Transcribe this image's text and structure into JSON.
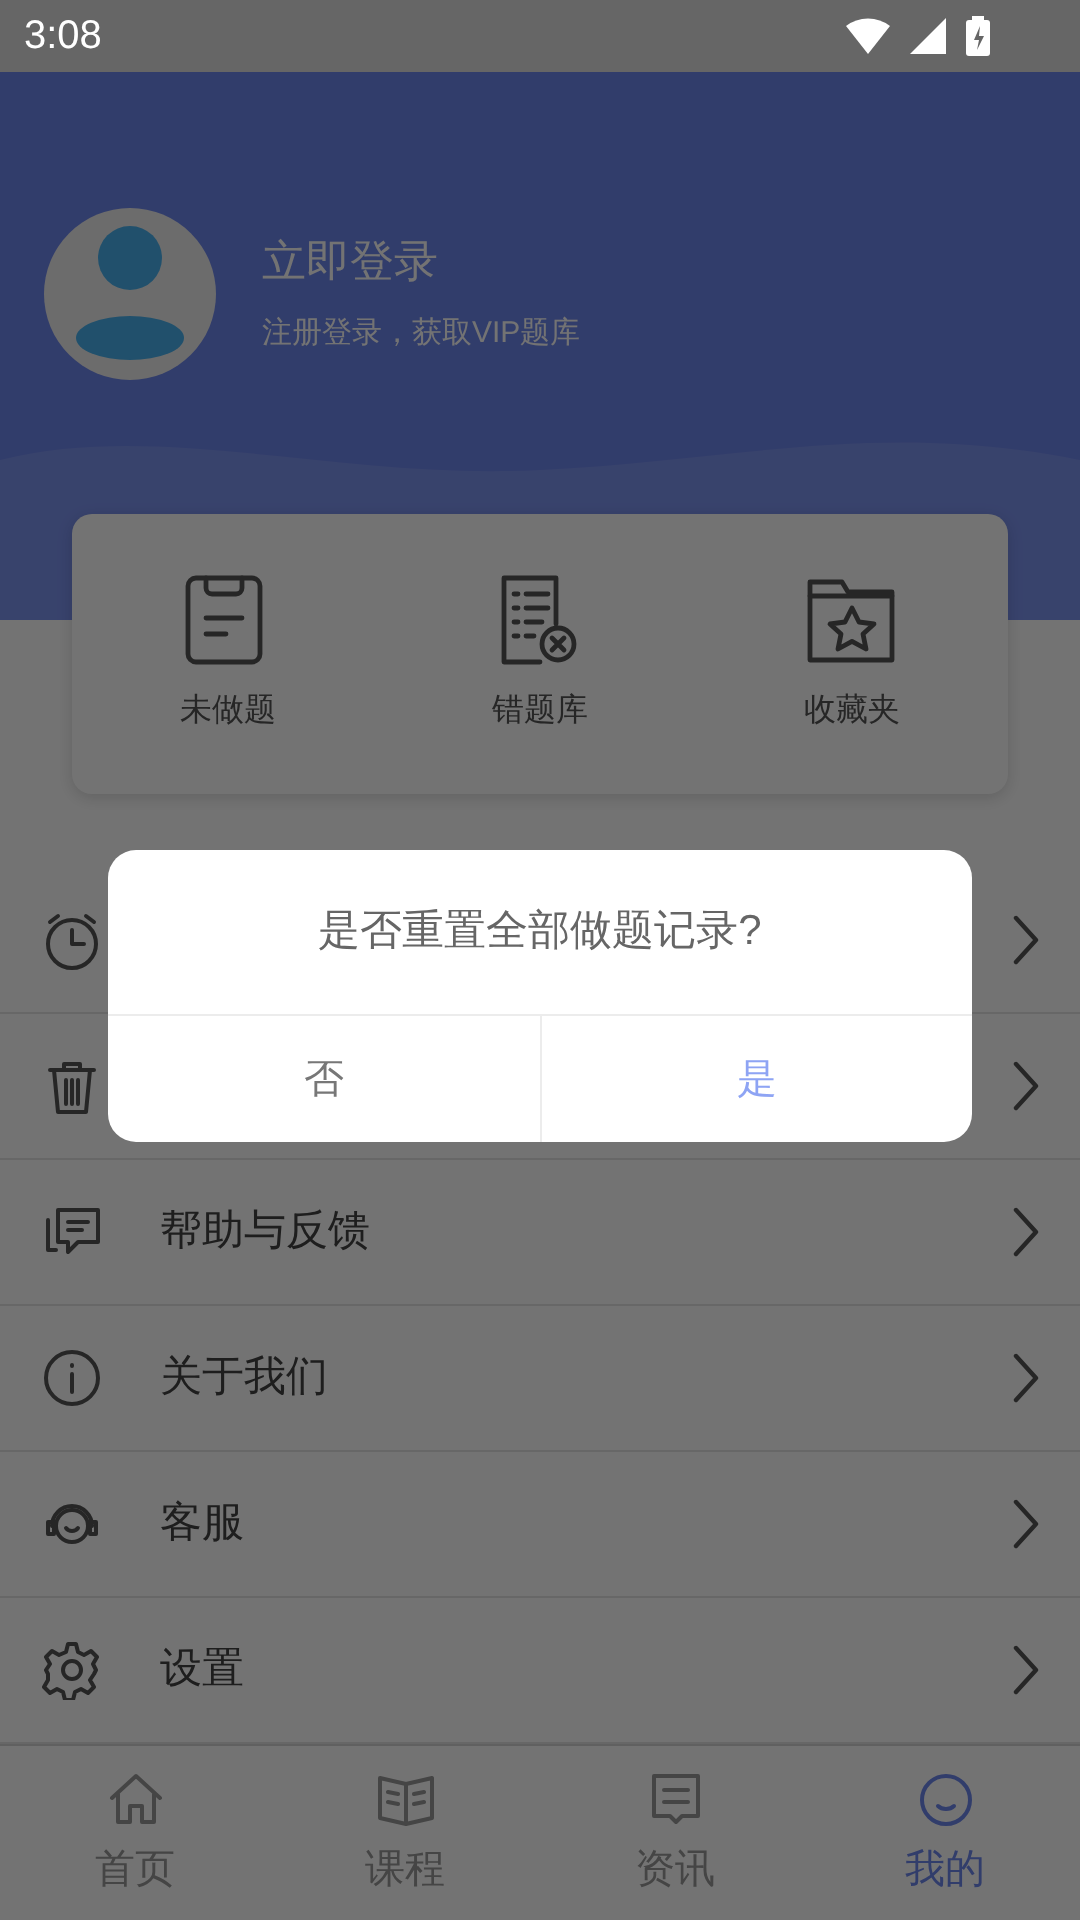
{
  "status_bar": {
    "time": "3:08"
  },
  "profile": {
    "title": "立即登录",
    "subtitle": "注册登录，获取VIP题库"
  },
  "shortcuts": [
    {
      "kind": "unanswered",
      "label": "未做题"
    },
    {
      "kind": "wrong",
      "label": "错题库"
    },
    {
      "kind": "favorites",
      "label": "收藏夹"
    }
  ],
  "menu": [
    {
      "kind": "clock"
    },
    {
      "kind": "trash"
    },
    {
      "kind": "feedback",
      "label": "帮助与反馈"
    },
    {
      "kind": "info",
      "label": "关于我们"
    },
    {
      "kind": "service",
      "label": "客服"
    },
    {
      "kind": "settings",
      "label": "设置"
    }
  ],
  "dialog": {
    "message": "是否重置全部做题记录?",
    "buttons": [
      {
        "kind": "cancel",
        "label": "否"
      },
      {
        "kind": "confirm",
        "label": "是"
      }
    ]
  },
  "tabs": [
    {
      "kind": "home",
      "label": "首页",
      "selected": false
    },
    {
      "kind": "course",
      "label": "课程",
      "selected": false
    },
    {
      "kind": "news",
      "label": "资讯",
      "selected": false
    },
    {
      "kind": "me",
      "label": "我的",
      "selected": true
    }
  ]
}
